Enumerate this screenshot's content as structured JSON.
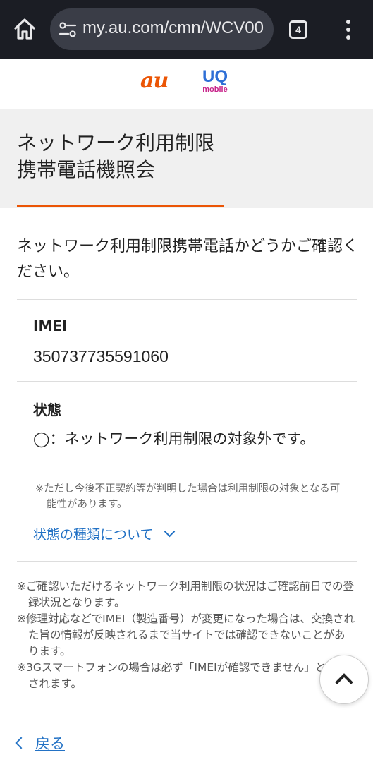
{
  "browser": {
    "url": "my.au.com/cmn/WCV00",
    "tab_count": "4"
  },
  "brand": {
    "au_logo": "au",
    "uq_logo": "UQ",
    "uq_logo_sub": "mobile"
  },
  "page": {
    "title_line1": "ネットワーク利用制限",
    "title_line2": "携帯電話機照会",
    "intro": "ネットワーク利用制限携帯電話かどうかご確認ください。"
  },
  "imei": {
    "label": "IMEI",
    "value": "350737735591060"
  },
  "status": {
    "label": "状態",
    "text": "◯：ネットワーク利用制限の対象外です。",
    "note": "※ただし今後不正契約等が判明した場合は利用制限の対象となる可能性があります。",
    "link": "状態の種類について"
  },
  "notes": [
    "※ご確認いただけるネットワーク利用制限の状況はご確認前日での登録状況となります。",
    "※修理対応などでIMEI（製造番号）が変更になった場合は、交換された旨の情報が反映されるまで当サイトでは確認できないことがあります。",
    "※3Gスマートフォンの場合は必ず「IMEIが確認できません」と表記されます。"
  ],
  "back_link": "戻る",
  "colors": {
    "accent": "#eb5505",
    "link": "#2372c5",
    "chrome_bg": "#1b1d24",
    "title_bg": "#f0f0f0"
  },
  "icons": [
    "home-icon",
    "site-settings-icon",
    "tab-switcher-icon",
    "overflow-menu-icon",
    "chevron-down-icon",
    "scroll-top-icon",
    "chevron-left-icon"
  ]
}
